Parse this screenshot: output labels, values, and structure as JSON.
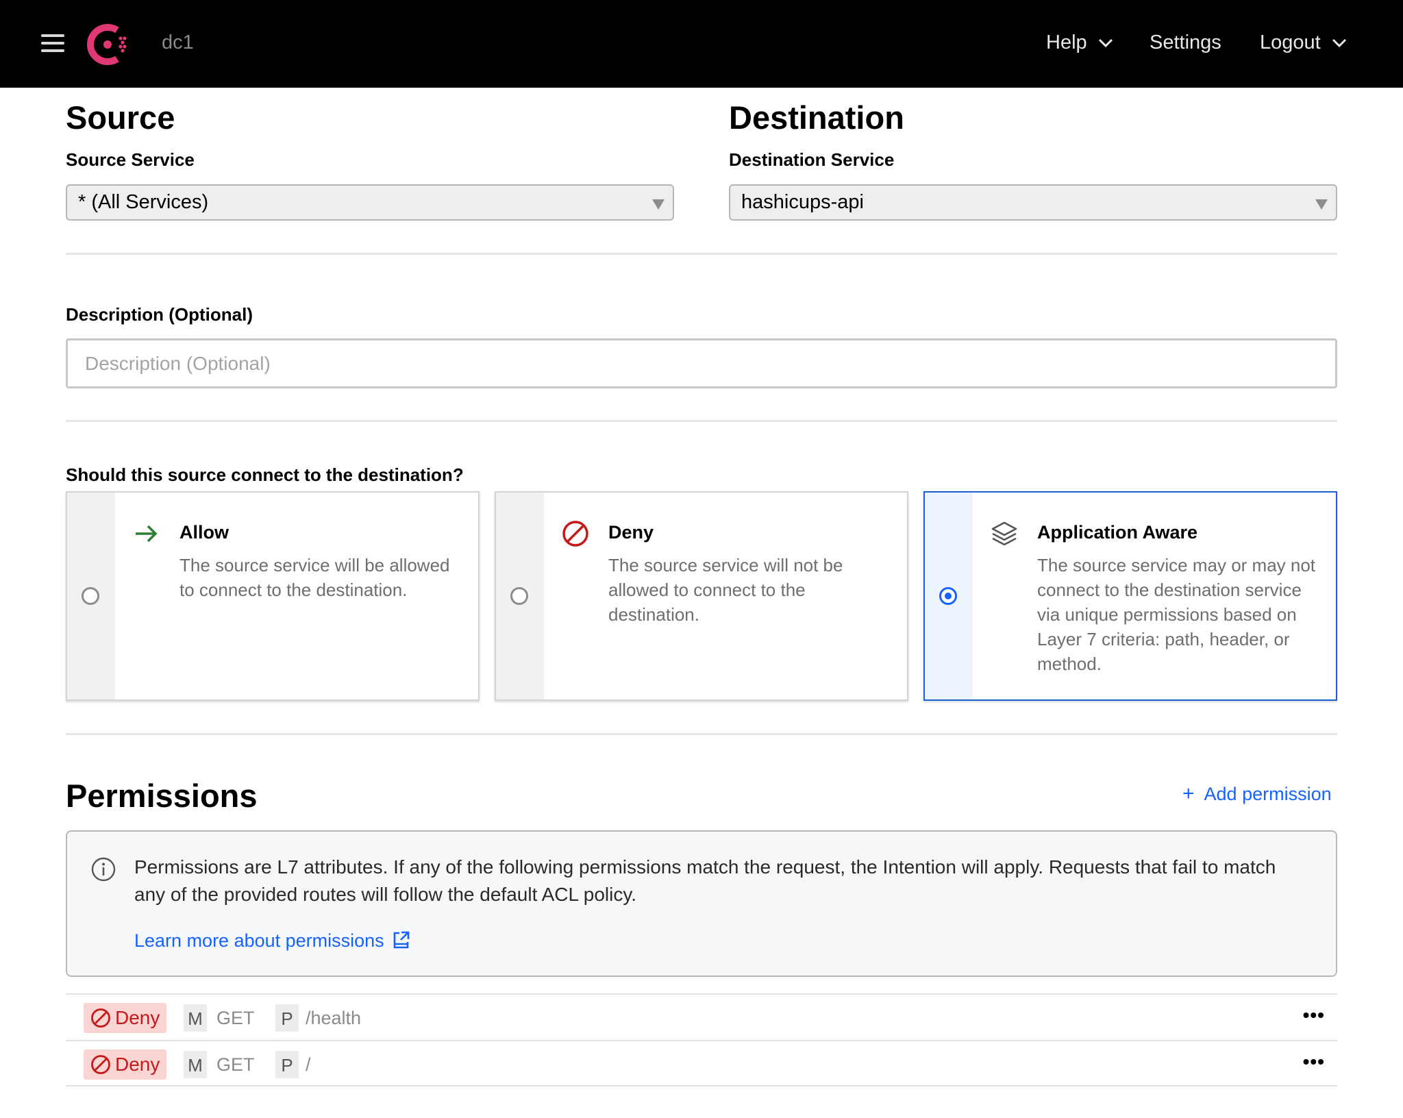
{
  "header": {
    "datacenter": "dc1",
    "nav": {
      "help": "Help",
      "settings": "Settings",
      "logout": "Logout"
    },
    "brand_color": "#e03875"
  },
  "source": {
    "heading": "Source",
    "service_label": "Source Service",
    "service_value": "* (All Services)"
  },
  "destination": {
    "heading": "Destination",
    "service_label": "Destination Service",
    "service_value": "hashicups-api"
  },
  "description": {
    "label": "Description (Optional)",
    "placeholder": "Description (Optional)",
    "value": ""
  },
  "connect": {
    "question": "Should this source connect to the destination?",
    "options": [
      {
        "title": "Allow",
        "text": "The source service will be allowed to connect to the destination.",
        "selected": false,
        "icon": "arrow-right-icon"
      },
      {
        "title": "Deny",
        "text": "The source service will not be allowed to connect to the destination.",
        "selected": false,
        "icon": "deny-icon"
      },
      {
        "title": "Application Aware",
        "text": "The source service may or may not connect to the destination service via unique permissions based on Layer 7 criteria: path, header, or method.",
        "selected": true,
        "icon": "layers-icon"
      }
    ]
  },
  "permissions": {
    "heading": "Permissions",
    "add_label": "Add permission",
    "notice": "Permissions are L7 attributes. If any of the following permissions match the request, the Intention will apply. Requests that fail to match any of the provided routes will follow the default ACL policy.",
    "learn_more": "Learn more about permissions",
    "rows": [
      {
        "action": "Deny",
        "method_key": "M",
        "method": "GET",
        "path_key": "P",
        "path": "/health",
        "menu": "•••"
      },
      {
        "action": "Deny",
        "method_key": "M",
        "method": "GET",
        "path_key": "P",
        "path": "/",
        "menu": "•••"
      }
    ]
  },
  "colors": {
    "accent": "#1563ff",
    "deny_text": "#c41a1a",
    "deny_bg": "#fbd4d4",
    "allow_icon": "#2e7d32"
  }
}
